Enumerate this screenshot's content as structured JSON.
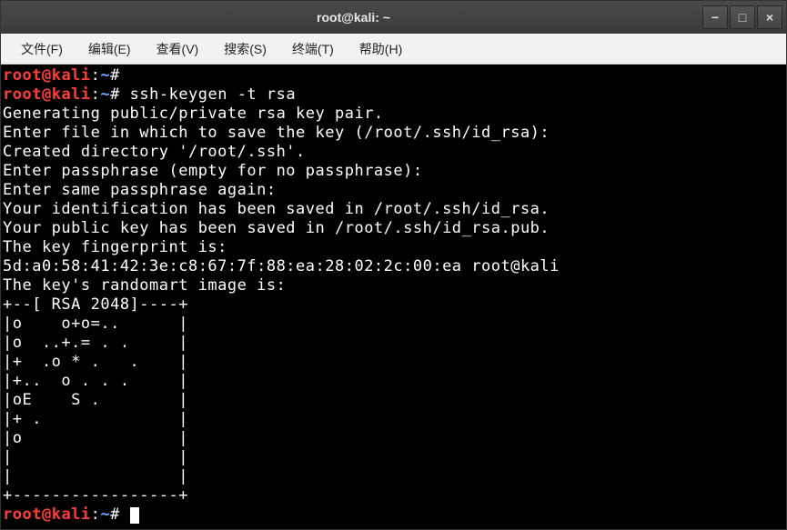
{
  "titlebar": {
    "title": "root@kali: ~"
  },
  "window_controls": {
    "minimize": "−",
    "maximize": "□",
    "close": "×"
  },
  "menubar": {
    "items": [
      "文件(F)",
      "编辑(E)",
      "查看(V)",
      "搜索(S)",
      "终端(T)",
      "帮助(H)"
    ]
  },
  "prompt": {
    "user": "root",
    "at": "@",
    "host": "kali",
    "colon": ":",
    "path": "~",
    "hash": "#"
  },
  "lines": {
    "l0_cmd": " ",
    "l1_cmd": " ssh-keygen -t rsa",
    "l2": "Generating public/private rsa key pair.",
    "l3": "Enter file in which to save the key (/root/.ssh/id_rsa):",
    "l4": "Created directory '/root/.ssh'.",
    "l5": "Enter passphrase (empty for no passphrase):",
    "l6": "Enter same passphrase again:",
    "l7": "Your identification has been saved in /root/.ssh/id_rsa.",
    "l8": "Your public key has been saved in /root/.ssh/id_rsa.pub.",
    "l9": "The key fingerprint is:",
    "l10": "5d:a0:58:41:42:3e:c8:67:7f:88:ea:28:02:2c:00:ea root@kali",
    "l11": "The key's randomart image is:",
    "l12": "+--[ RSA 2048]----+",
    "l13": "|o    o+o=..      |",
    "l14": "|o  ..+.= . .     |",
    "l15": "|+  .o * .   .    |",
    "l16": "|+..  o . . .     |",
    "l17": "|oE    S .        |",
    "l18": "|+ .              |",
    "l19": "|o                |",
    "l20": "|                 |",
    "l21": "|                 |",
    "l22": "+-----------------+",
    "l23_cmd": " "
  }
}
